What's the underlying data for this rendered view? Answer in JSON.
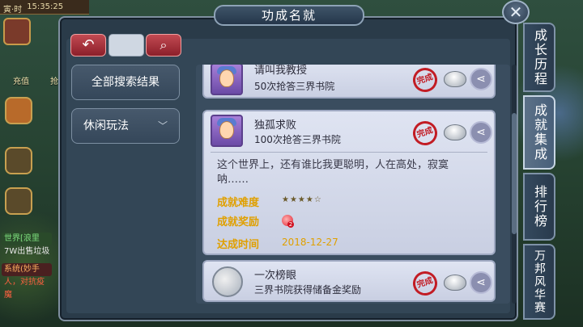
{
  "hud": {
    "period": "寅·时",
    "time": "15:35:25",
    "recharge": "充值",
    "recharge_partial": "抢",
    "chat_world_tag": "世界",
    "chat_world_text": "[浪里",
    "chat_line2": "7W出售垃圾",
    "chat_clan_tag": "系统",
    "chat_clan_text": "(妙手",
    "chat_line4": "人，对抗疫魔"
  },
  "panel": {
    "title": "功成名就",
    "close_icon": "close-icon"
  },
  "search": {
    "value": "",
    "placeholder": ""
  },
  "filters": {
    "all_results": "全部搜索结果",
    "category": "休闲玩法"
  },
  "tabs": [
    {
      "label": "成长历程",
      "active": false
    },
    {
      "label": "成就集成",
      "active": true
    },
    {
      "label": "排行榜",
      "active": false
    },
    {
      "label": "万邦风华赛",
      "active": false
    }
  ],
  "achievements": [
    {
      "title": "请叫我教授",
      "subtitle": "50次抢答三界书院",
      "stamp": "完成"
    },
    {
      "title": "独孤求败",
      "subtitle": "100次抢答三界书院",
      "stamp": "完成",
      "description": "这个世界上，还有谁比我更聪明，人在高处，寂寞呐……",
      "difficulty_label": "成就难度",
      "difficulty_stars": "★★★★☆",
      "reward_label": "成就奖励",
      "reward_count": "2",
      "date_label": "达成时间",
      "date": "2018-12-27"
    },
    {
      "title": "一次榜眼",
      "subtitle": "三界书院获得储备金奖励",
      "stamp": "完成"
    }
  ],
  "colors": {
    "accent_red": "#c21c24",
    "highlight_gold": "#e0a000",
    "panel_bg": "#2a3b49"
  }
}
